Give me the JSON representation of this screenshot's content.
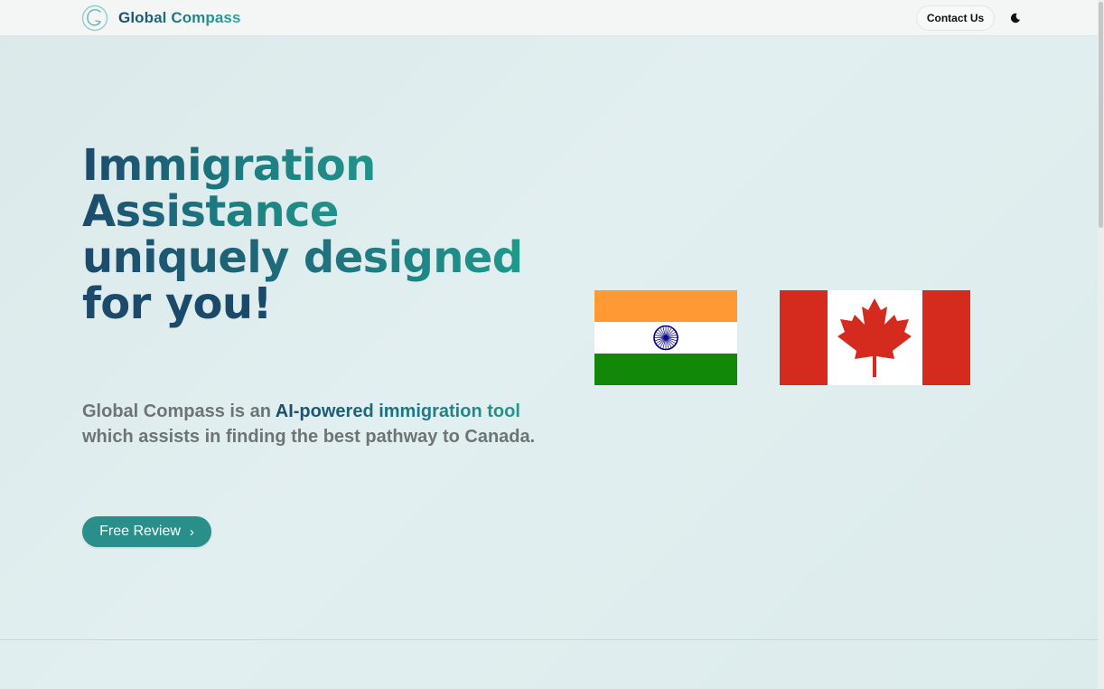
{
  "header": {
    "brand": "Global Compass",
    "logo_icon": "compass-logo-icon",
    "contact_label": "Contact Us",
    "theme_icon": "moon-icon"
  },
  "hero": {
    "title_lines": [
      "Immigration",
      "Assistance",
      "uniquely designed",
      "for you!"
    ],
    "description_prefix": "Global Compass is an ",
    "description_highlight": "AI-powered immigration tool",
    "description_suffix": " which assists in finding the best pathway to Canada.",
    "cta_label": "Free Review",
    "cta_icon": "chevron-right-icon"
  },
  "flags": [
    "india-flag",
    "canada-flag"
  ],
  "colors": {
    "accent": "#2a8e8a",
    "title_dark": "#1b4a6b",
    "title_teal": "#209489",
    "body_text": "#6e7474"
  }
}
